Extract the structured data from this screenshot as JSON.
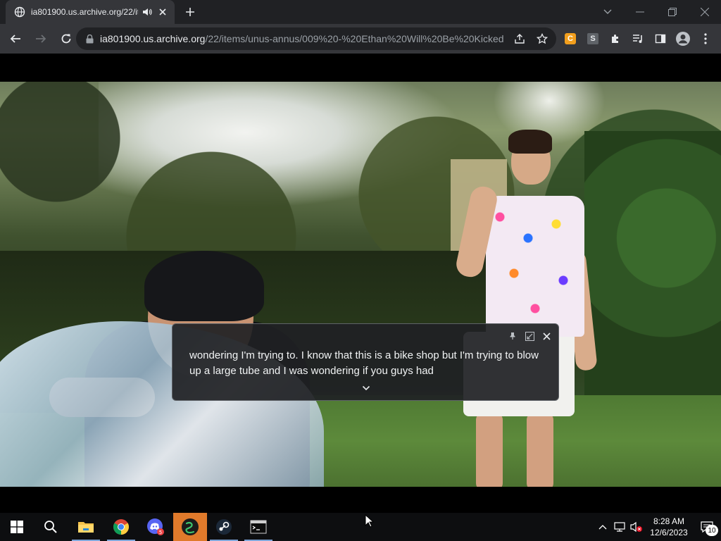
{
  "browser": {
    "tab": {
      "title": "ia801900.us.archive.org/22/items/unus-annus/009%20-%20Ethan%20Will%20Be%20Kicked..."
    },
    "address": {
      "host": "ia801900.us.archive.org",
      "path": "/22/items/unus-annus/009%20-%20Ethan%20Will%20Be%20Kicked..."
    },
    "extensions": {
      "ext1_letter": "C",
      "ext2_letter": "S"
    }
  },
  "caption": {
    "text": "wondering I'm trying to. I know that this is a bike shop but I'm trying to blow up a large tube and I was wondering if you guys had"
  },
  "taskbar": {
    "time": "8:28 AM",
    "date": "12/6/2023",
    "notification_count": "10"
  },
  "colors": {
    "tab_strip": "#202124",
    "toolbar": "#35363a",
    "taskbar": "#0d0e10",
    "active_app": "#e07a2b"
  }
}
